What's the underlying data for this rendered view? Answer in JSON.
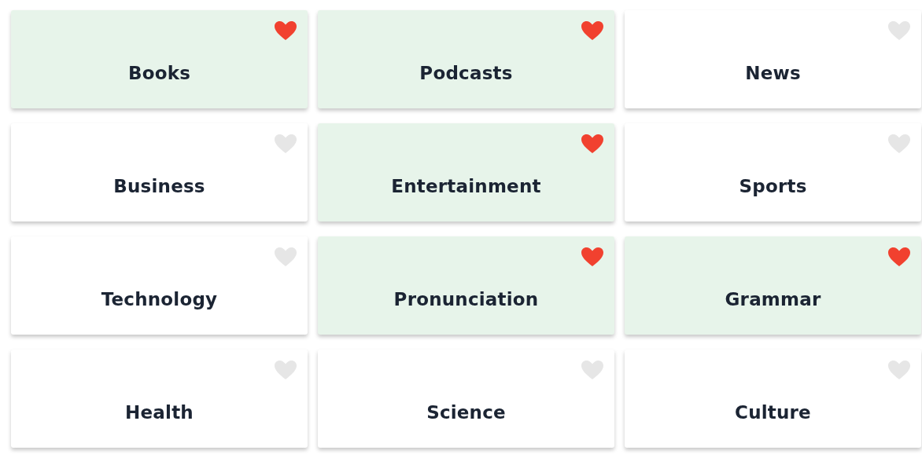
{
  "cards": [
    {
      "label": "Books",
      "selected": true
    },
    {
      "label": "Podcasts",
      "selected": true
    },
    {
      "label": "News",
      "selected": false
    },
    {
      "label": "Business",
      "selected": false
    },
    {
      "label": "Entertainment",
      "selected": true
    },
    {
      "label": "Sports",
      "selected": false
    },
    {
      "label": "Technology",
      "selected": false
    },
    {
      "label": "Pronunciation",
      "selected": true
    },
    {
      "label": "Grammar",
      "selected": true
    },
    {
      "label": "Health",
      "selected": false
    },
    {
      "label": "Science",
      "selected": false
    },
    {
      "label": "Culture",
      "selected": false
    }
  ]
}
